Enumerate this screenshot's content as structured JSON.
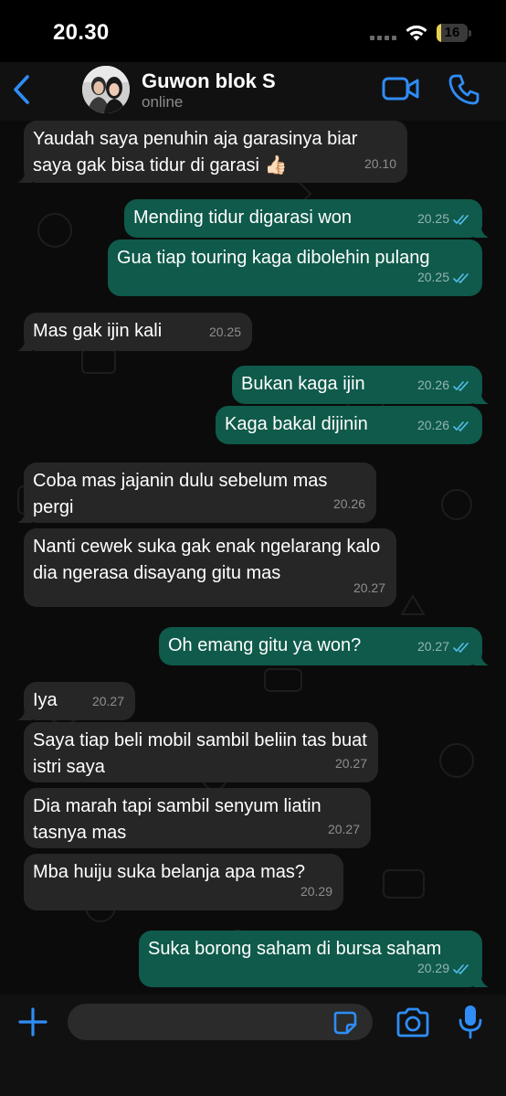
{
  "status_bar": {
    "time": "20.30",
    "battery_level": "16",
    "battery_fraction": 0.16,
    "battery_color": "#e8d253"
  },
  "header": {
    "back_icon": "chevron-left-icon",
    "contact_name": "Guwon blok S",
    "contact_status": "online",
    "video_icon": "video-camera-icon",
    "phone_icon": "phone-icon",
    "accent_color": "#2f8df6"
  },
  "messages": [
    {
      "direction": "in",
      "text": "Yaudah saya penuhin aja garasinya biar saya gak bisa tidur di garasi 👍🏻",
      "time": "20.10"
    },
    {
      "direction": "out",
      "text": "Mending tidur digarasi won",
      "time": "20.25",
      "status": "read"
    },
    {
      "direction": "out",
      "text": "Gua tiap touring kaga dibolehin pulang",
      "time": "20.25",
      "status": "read"
    },
    {
      "direction": "in",
      "text": "Mas gak ijin kali",
      "time": "20.25"
    },
    {
      "direction": "out",
      "text": "Bukan kaga ijin",
      "time": "20.26",
      "status": "read"
    },
    {
      "direction": "out",
      "text": "Kaga bakal dijinin",
      "time": "20.26",
      "status": "read"
    },
    {
      "direction": "in",
      "text": "Coba mas jajanin dulu sebelum mas pergi",
      "time": "20.26"
    },
    {
      "direction": "in",
      "text": "Nanti cewek suka gak enak ngelarang kalo dia ngerasa disayang gitu mas",
      "time": "20.27"
    },
    {
      "direction": "out",
      "text": "Oh emang gitu ya won?",
      "time": "20.27",
      "status": "read"
    },
    {
      "direction": "in",
      "text": "Iya",
      "time": "20.27"
    },
    {
      "direction": "in",
      "text": "Saya tiap beli mobil sambil beliin tas buat istri saya",
      "time": "20.27"
    },
    {
      "direction": "in",
      "text": "Dia marah tapi sambil senyum liatin tasnya mas",
      "time": "20.27"
    },
    {
      "direction": "in",
      "text": "Mba huiju suka belanja apa mas?",
      "time": "20.29"
    },
    {
      "direction": "out",
      "text": "Suka borong saham di bursa saham",
      "time": "20.29",
      "status": "read"
    }
  ],
  "colors": {
    "incoming_bubble": "#262626",
    "outgoing_bubble": "#0f5a4b",
    "read_ticks": "#53bdeb"
  },
  "input_bar": {
    "placeholder": "",
    "attach_icon": "plus-icon",
    "sticker_icon": "sticker-icon",
    "camera_icon": "camera-icon",
    "mic_icon": "microphone-icon"
  }
}
